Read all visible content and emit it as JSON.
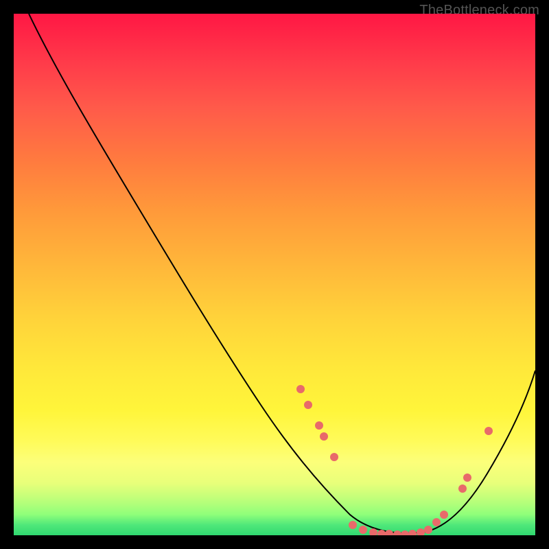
{
  "watermark": "TheBottleneck.com",
  "chart_data": {
    "type": "line",
    "title": "",
    "xlabel": "",
    "ylabel": "",
    "xlim": [
      0,
      100
    ],
    "ylim": [
      0,
      100
    ],
    "grid": false,
    "legend": false,
    "series": [
      {
        "name": "bottleneck-curve",
        "x": [
          3,
          8,
          14,
          20,
          26,
          32,
          38,
          44,
          50,
          55,
          58,
          61,
          64,
          67,
          70,
          73,
          76,
          79,
          82,
          86,
          90,
          94,
          98,
          100
        ],
        "y": [
          100,
          93,
          85,
          77,
          69,
          61,
          53,
          45,
          37,
          28,
          22,
          16,
          10,
          5,
          2,
          0,
          0,
          0,
          2,
          6,
          12,
          20,
          30,
          36
        ],
        "color": "#000000"
      }
    ],
    "markers": [
      {
        "x": 55,
        "y": 28
      },
      {
        "x": 56.5,
        "y": 25
      },
      {
        "x": 58.5,
        "y": 21
      },
      {
        "x": 59.5,
        "y": 19
      },
      {
        "x": 61.5,
        "y": 15
      },
      {
        "x": 65,
        "y": 2
      },
      {
        "x": 67,
        "y": 1
      },
      {
        "x": 69,
        "y": 0.5
      },
      {
        "x": 70.5,
        "y": 0.3
      },
      {
        "x": 72,
        "y": 0.2
      },
      {
        "x": 73.5,
        "y": 0.1
      },
      {
        "x": 75,
        "y": 0.1
      },
      {
        "x": 76.5,
        "y": 0.2
      },
      {
        "x": 78,
        "y": 0.5
      },
      {
        "x": 79.5,
        "y": 1
      },
      {
        "x": 81,
        "y": 2.5
      },
      {
        "x": 82.5,
        "y": 4
      },
      {
        "x": 86,
        "y": 9
      },
      {
        "x": 87,
        "y": 11
      },
      {
        "x": 91,
        "y": 20
      }
    ],
    "background_gradient": [
      "#ff1744",
      "#ffd23a",
      "#fff53a",
      "#30d870"
    ]
  }
}
